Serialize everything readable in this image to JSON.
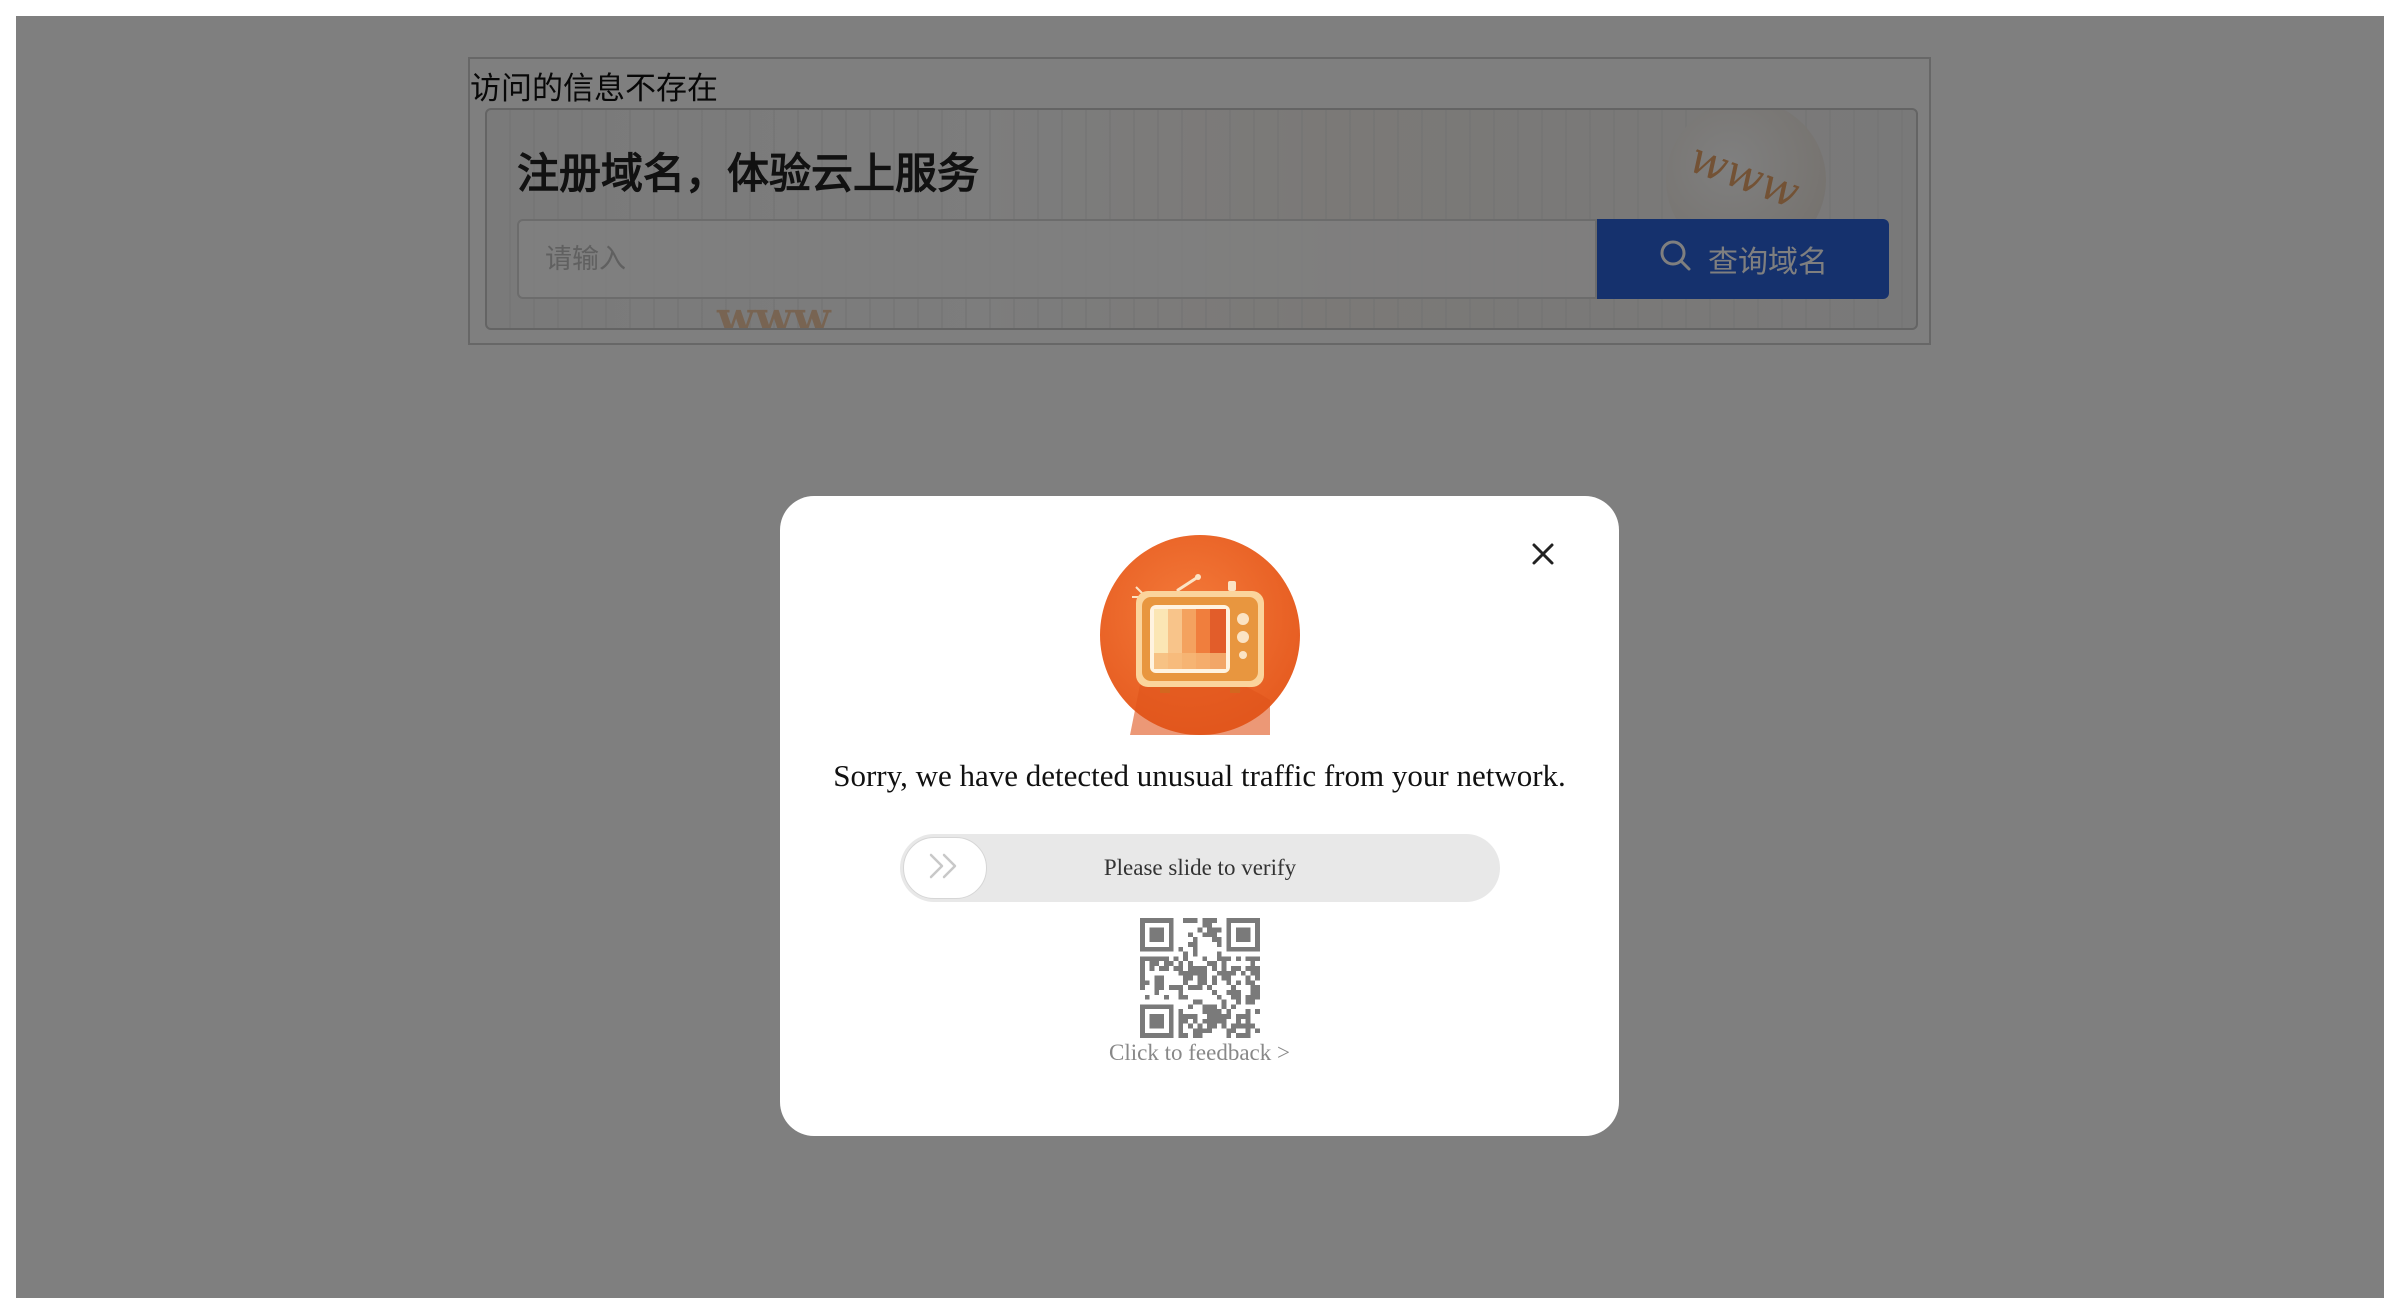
{
  "page": {
    "notice_title": "访问的信息不存在"
  },
  "banner": {
    "title": "注册域名，体验云上服务",
    "decor_text": "www",
    "search_placeholder": "请输入",
    "search_value": "",
    "query_button_label": "查询域名",
    "query_icon": "search-icon",
    "accent_color": "#2b62db"
  },
  "modal": {
    "close_icon": "close-icon",
    "illustration": "retro-tv-illustration",
    "message": "Sorry, we have detected unusual traffic from your network.",
    "slider_label": "Please slide to verify",
    "slider_icon": "double-chevron-right-icon",
    "feedback_link": "Click to feedback >",
    "overlay_color": "rgba(0,0,0,0.5)",
    "illustration_color": "#ee6a2c"
  }
}
